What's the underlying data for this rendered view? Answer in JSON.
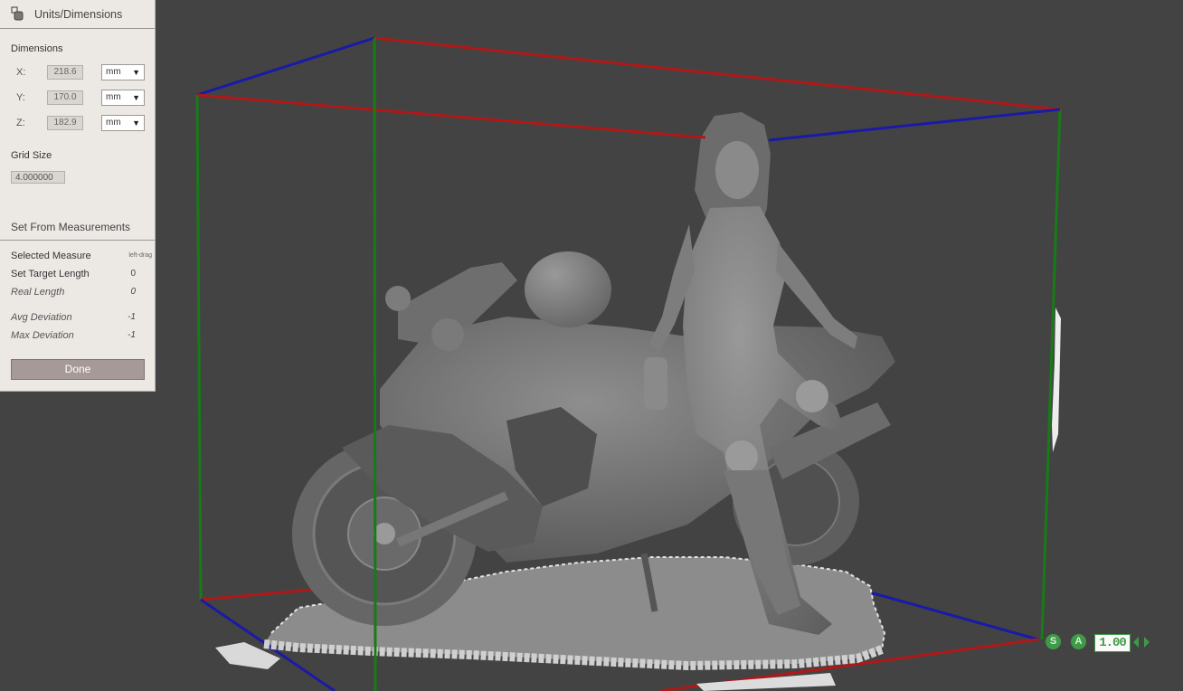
{
  "panel": {
    "title": "Units/Dimensions",
    "dimensions_label": "Dimensions",
    "rows": [
      {
        "axis": "X:",
        "value": "218.6",
        "unit": "mm"
      },
      {
        "axis": "Y:",
        "value": "170.0",
        "unit": "mm"
      },
      {
        "axis": "Z:",
        "value": "182.9",
        "unit": "mm"
      }
    ],
    "grid_size_label": "Grid Size",
    "grid_size_value": "4.000000",
    "set_from_label": "Set From Measurements",
    "selected_measure_label": "Selected Measure",
    "selected_measure_hint": "left-drag",
    "target_length_label": "Set Target Length",
    "target_length_value": "0",
    "real_length_label": "Real Length",
    "real_length_value": "0",
    "avg_dev_label": "Avg Deviation",
    "avg_dev_value": "-1",
    "max_dev_label": "Max Deviation",
    "max_dev_value": "-1",
    "done_label": "Done"
  },
  "hud": {
    "s_label": "S",
    "a_label": "A",
    "scale_value": "1.00"
  },
  "colors": {
    "viewport_bg": "#434343",
    "axis_x": "#b01818",
    "axis_y": "#1a1aa8",
    "axis_z": "#187a18",
    "hud_green": "#3f9a47"
  }
}
